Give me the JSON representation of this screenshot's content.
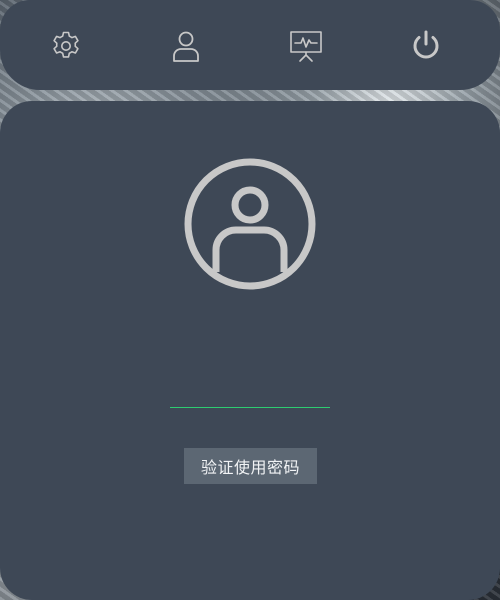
{
  "toolbar": {
    "items": [
      {
        "icon": "gear-icon",
        "label": "settings"
      },
      {
        "icon": "user-icon",
        "label": "user"
      },
      {
        "icon": "presentation-icon",
        "label": "monitor"
      },
      {
        "icon": "power-icon",
        "label": "power"
      }
    ]
  },
  "login": {
    "avatar_icon": "user-avatar-icon",
    "password_value": "",
    "verify_button_label": "验证使用密码"
  },
  "colors": {
    "panel": "#3e4856",
    "icon": "#c8c8c8",
    "field_underline": "#2ecc71",
    "button": "#5c6773"
  }
}
